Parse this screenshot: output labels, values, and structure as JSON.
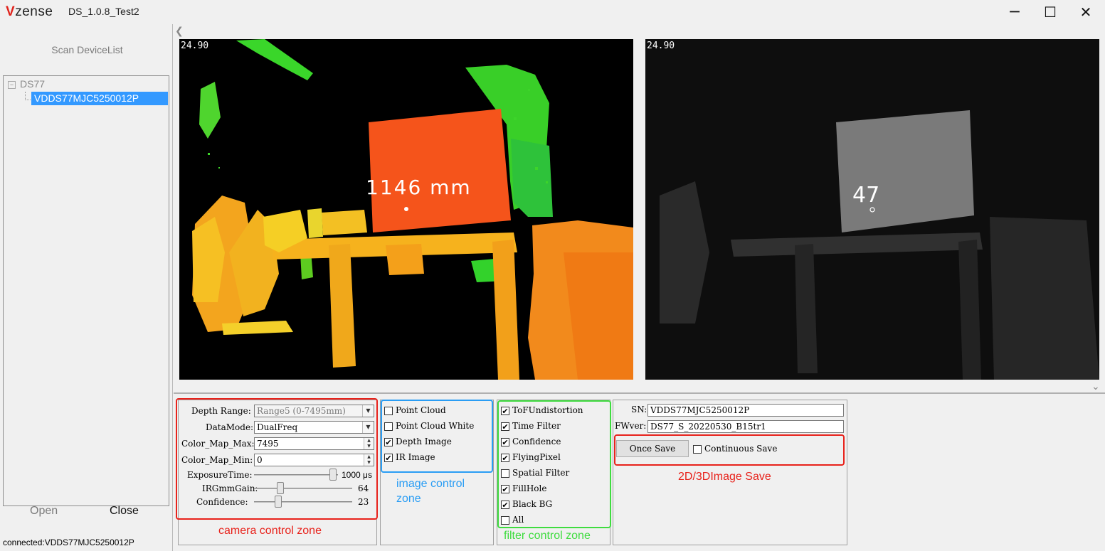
{
  "app": {
    "brand": "Vzense",
    "brand_first": "V",
    "brand_rest": "zense",
    "title": "DS_1.0.8_Test2"
  },
  "window_controls": {
    "minimize": "─",
    "maximize": "☐",
    "close": "✕"
  },
  "left": {
    "scan_label": "Scan DeviceList",
    "tree_root": "DS77",
    "tree_child": "VDDS77MJC5250012P",
    "open_label": "Open",
    "close_label": "Close",
    "status": "connected:VDDS77MJC5250012P"
  },
  "views": {
    "depth": {
      "fps": "24.90",
      "measure": "1146 mm"
    },
    "ir": {
      "fps": "24.90",
      "measure": "47"
    }
  },
  "camera": {
    "depth_range_label": "Depth Range:",
    "depth_range_value": "Range5 (0-7495mm)",
    "datamode_label": "DataMode:",
    "datamode_value": "DualFreq",
    "cmap_max_label": "Color_Map_Max:",
    "cmap_max_value": "7495",
    "cmap_min_label": "Color_Map_Min:",
    "cmap_min_value": "0",
    "exposure_label": "ExposureTime:",
    "exposure_value": "1000 μs",
    "exposure_fraction": 0.98,
    "irgain_label": "IRGmmGain:",
    "irgain_value": "64",
    "irgain_fraction": 0.25,
    "conf_label": "Confidence:",
    "conf_value": "23",
    "conf_fraction": 0.23
  },
  "image_ctrl": [
    {
      "label": "Point Cloud",
      "checked": false
    },
    {
      "label": "Point Cloud White",
      "checked": false
    },
    {
      "label": "Depth Image",
      "checked": true
    },
    {
      "label": "IR Image",
      "checked": true
    }
  ],
  "filters": [
    {
      "label": "ToFUndistortion",
      "checked": true
    },
    {
      "label": "Time Filter",
      "checked": true
    },
    {
      "label": "Confidence",
      "checked": true
    },
    {
      "label": "FlyingPixel",
      "checked": true
    },
    {
      "label": "Spatial Filter",
      "checked": false
    },
    {
      "label": "FillHole",
      "checked": true
    },
    {
      "label": "Black BG",
      "checked": true
    },
    {
      "label": "All",
      "checked": false
    }
  ],
  "info": {
    "sn_label": "SN:",
    "sn_value": "VDDS77MJC5250012P",
    "fw_label": "FWver:",
    "fw_value": "DS77_S_20220530_B15tr1",
    "once_save": "Once Save",
    "continuous_save": "Continuous Save"
  },
  "annotations": {
    "camera": "camera control zone",
    "image_l1": "image control",
    "image_l2": "zone",
    "filter": "filter control zone",
    "save": "2D/3DImage Save"
  },
  "colors": {
    "annot_red": "#e8221b",
    "annot_blue": "#2a9df4",
    "annot_green": "#3fdc3f",
    "selection": "#3399ff"
  }
}
